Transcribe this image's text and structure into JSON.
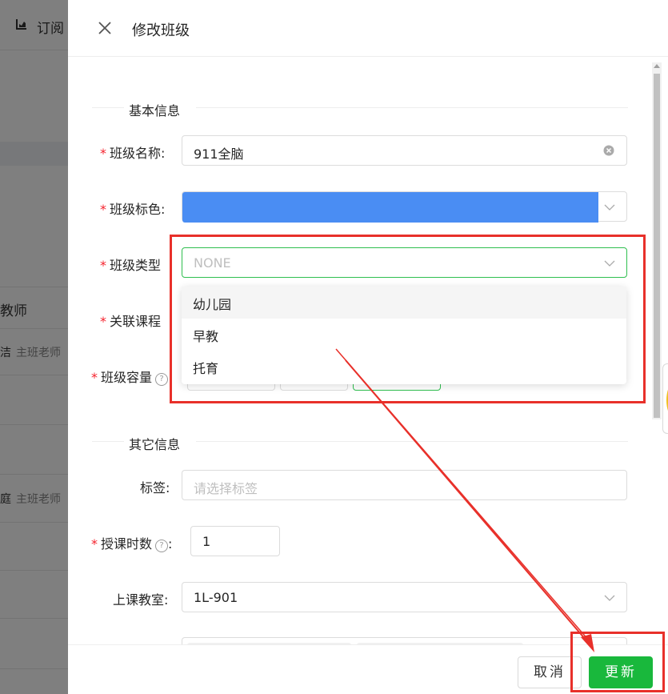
{
  "background": {
    "top_tab_label": "订阅",
    "header_fragment": "教师",
    "rows": [
      {
        "name_fragment": "洁",
        "role": "主班老师"
      },
      {
        "name_fragment": "庭",
        "role": "主班老师"
      }
    ]
  },
  "drawer": {
    "title": "修改班级",
    "sections": {
      "basic": "基本信息",
      "other": "其它信息"
    },
    "fields": {
      "class_name": {
        "label": "班级名称:",
        "value": "911全脑"
      },
      "class_color": {
        "label": "班级标色:",
        "value_color": "#4a8df3"
      },
      "class_type": {
        "label": "班级类型",
        "value": "NONE"
      },
      "linked_course": {
        "label": "关联课程"
      },
      "capacity": {
        "label": "班级容量"
      },
      "tags": {
        "label": "标签:",
        "placeholder": "请选择标签"
      },
      "lesson_hours": {
        "label": "授课时数",
        "colon": ":",
        "value": "1"
      },
      "classroom": {
        "label": "上课教室:",
        "value": "1L-901"
      }
    },
    "class_type_options": [
      "幼儿园",
      "早教",
      "托育"
    ],
    "footer": {
      "cancel_label": "取消",
      "update_label": "更新"
    }
  },
  "colors": {
    "accent_green": "#19b83c",
    "required_red": "#f5222d",
    "annotation_red": "#e8302a"
  }
}
